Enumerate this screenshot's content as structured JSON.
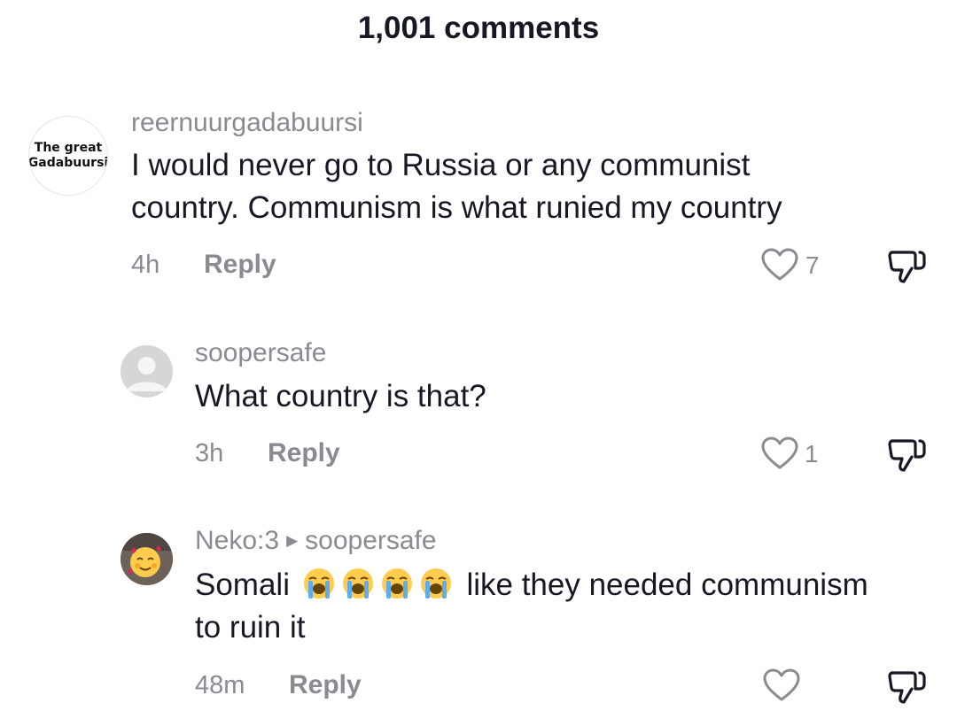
{
  "header": {
    "title": "1,001 comments"
  },
  "comments": [
    {
      "avatar_text_line1": "The great",
      "avatar_text_line2": "Gadabuursi",
      "username": "reernuurgadabuursi",
      "text_line1": "I would never go to Russia or any communist",
      "text_line2": "country. Communism is what runied my country",
      "time": "4h",
      "reply_label": "Reply",
      "likes": "7"
    },
    {
      "username": "soopersafe",
      "text": "What country is that?",
      "time": "3h",
      "reply_label": "Reply",
      "likes": "1"
    },
    {
      "username": "Neko:3",
      "reply_arrow": "▶",
      "reply_to": "soopersafe",
      "text_part1": "Somali",
      "text_part2": "like they needed communism",
      "text_line2": "to ruin it",
      "time": "48m",
      "reply_label": "Reply",
      "likes": ""
    }
  ],
  "icons": {
    "like": "heart-outline-icon",
    "dislike": "thumbs-down-outline-icon",
    "emoji": "loudly-crying-face-emoji"
  },
  "colors": {
    "muted": "#8a8b91",
    "text": "#161823"
  }
}
